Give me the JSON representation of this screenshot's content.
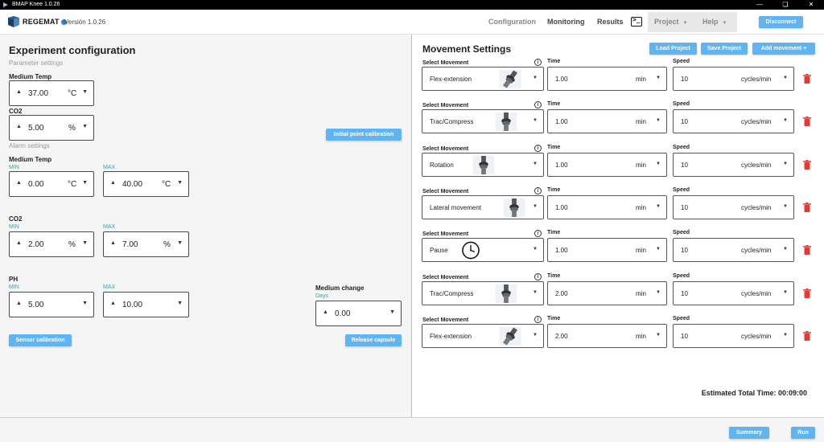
{
  "window": {
    "title": "BMAP Knee 1.0.26"
  },
  "header": {
    "brand": "REGEMAT",
    "version": "Versión 1.0.26",
    "nav": {
      "configuration": "Configuration",
      "monitoring": "Monitoring",
      "results": "Results",
      "project": "Project",
      "help": "Help"
    },
    "disconnect": "Disconnect",
    "terminal_icon": ">_"
  },
  "experiment": {
    "title": "Experiment configuration",
    "parameter_settings": "Parameter settings",
    "medium_temp_label": "Medium Temp",
    "medium_temp_value": "37.00",
    "medium_temp_unit": "°C",
    "co2_label": "CO2",
    "co2_value": "5.00",
    "co2_unit": "%",
    "initial_point_calibration": "Initial point calibration",
    "alarm_settings": "Alarm settings",
    "alarm_temp": {
      "label": "Medium Temp",
      "min_label": "MIN",
      "min_value": "0.00",
      "max_label": "MAX",
      "max_value": "40.00",
      "unit": "°C"
    },
    "alarm_co2": {
      "label": "CO2",
      "min_label": "MIN",
      "min_value": "2.00",
      "max_label": "MAX",
      "max_value": "7.00",
      "unit": "%"
    },
    "alarm_ph": {
      "label": "PH",
      "min_label": "MIN",
      "min_value": "5.00",
      "max_label": "MAX",
      "max_value": "10.00"
    },
    "medium_change": {
      "label": "Medium change",
      "unit_label": "Days",
      "value": "0.00"
    },
    "sensor_calibration": "Sensor calibration",
    "release_capsule": "Release capsule"
  },
  "movement": {
    "title": "Movement Settings",
    "load_project": "Load Project",
    "save_project": "Save Project",
    "add_movement": "Add movement +",
    "select_label": "Select Movement",
    "time_label": "Time",
    "speed_label": "Speed",
    "rows": [
      {
        "movement": "Flex-extension",
        "time": "1.00",
        "time_unit": "min",
        "speed": "10",
        "speed_unit": "cycles/min",
        "icon": "knee-flex-icon"
      },
      {
        "movement": "Trac/Compress",
        "time": "1.00",
        "time_unit": "min",
        "speed": "10",
        "speed_unit": "cycles/min",
        "icon": "knee-trac-icon"
      },
      {
        "movement": "Rotation",
        "time": "1.00",
        "time_unit": "min",
        "speed": "10",
        "speed_unit": "cycles/min",
        "icon": "knee-rotation-icon"
      },
      {
        "movement": "Lateral movement",
        "time": "1.00",
        "time_unit": "min",
        "speed": "10",
        "speed_unit": "cycles/min",
        "icon": "knee-lateral-icon"
      },
      {
        "movement": "Pause",
        "time": "1.00",
        "time_unit": "min",
        "speed": "10",
        "speed_unit": "cycles/min",
        "icon": "clock-icon"
      },
      {
        "movement": "Trac/Compress",
        "time": "2.00",
        "time_unit": "min",
        "speed": "10",
        "speed_unit": "cycles/min",
        "icon": "knee-trac-icon"
      },
      {
        "movement": "Flex-extension",
        "time": "2.00",
        "time_unit": "min",
        "speed": "10",
        "speed_unit": "cycles/min",
        "icon": "knee-flex-icon"
      }
    ],
    "estimated_total": "Estimated Total Time: 00:09:00"
  },
  "footer": {
    "summary": "Summary",
    "run": "Run"
  },
  "colors": {
    "accent": "#60b4f2",
    "teal": "#2aa6b6",
    "trash": "#e53935"
  }
}
